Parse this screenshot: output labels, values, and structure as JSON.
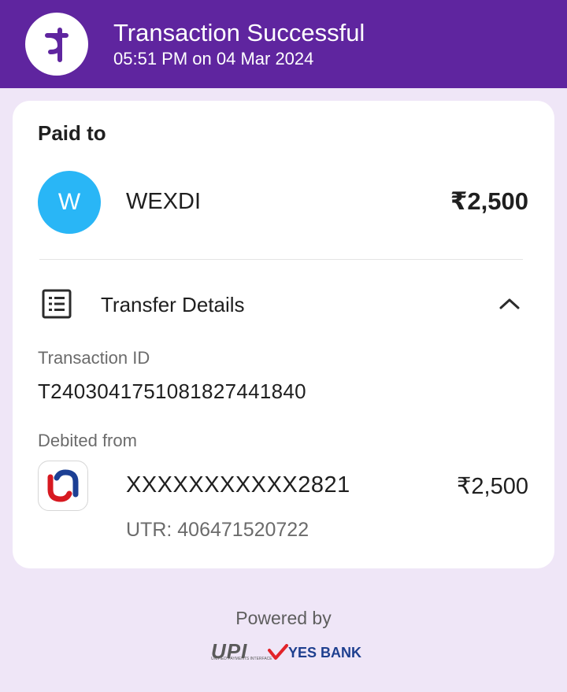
{
  "header": {
    "title": "Transaction Successful",
    "subtitle": "05:51 PM on 04 Mar 2024",
    "logo_icon": "phonepe-logo-icon",
    "background": "#5f259f"
  },
  "paid_to": {
    "label": "Paid to",
    "avatar_initial": "W",
    "avatar_color": "#29b6f6",
    "name": "WEXDI",
    "amount": "₹2,500"
  },
  "transfer_details": {
    "title": "Transfer Details",
    "icon": "receipt-list-icon",
    "toggle_icon": "chevron-up-icon",
    "transaction_id_label": "Transaction ID",
    "transaction_id": "T2403041751081827441840",
    "debited_from_label": "Debited from",
    "bank_icon": "union-bank-logo-icon",
    "account": "XXXXXXXXXXX2821",
    "debit_amount": "₹2,500",
    "utr": "UTR: 406471520722"
  },
  "footer": {
    "powered_by": "Powered by",
    "upi_logo_text": "UPI",
    "upi_tagline": "UNIFIED PAYMENTS INTERFACE",
    "bank_partner": "YES BANK"
  }
}
